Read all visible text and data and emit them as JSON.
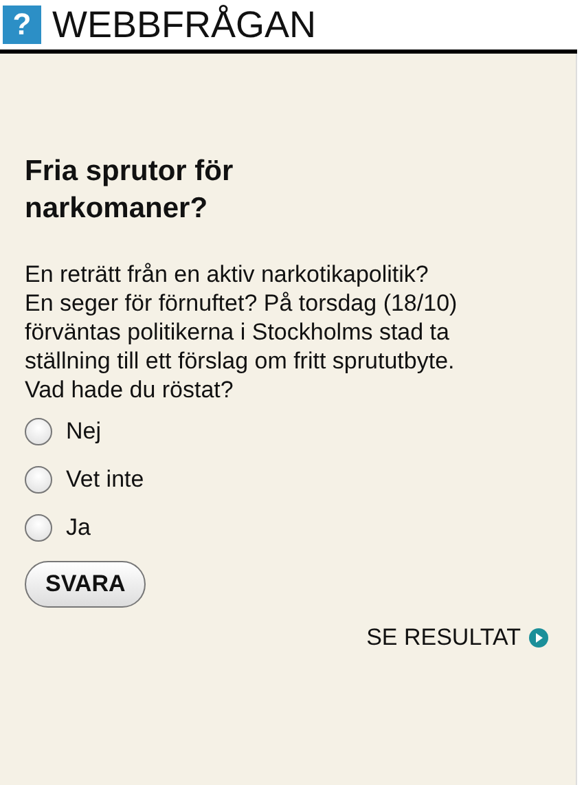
{
  "header": {
    "icon": "?",
    "title": "WEBBFRÅGAN"
  },
  "poll": {
    "question": "Fria sprutor för narkomaner?",
    "description": "En reträtt från en aktiv narkotikapolitik? En seger för förnuftet? På torsdag (18/10) förväntas politikerna i Stockholms stad ta ställning till ett förslag om fritt sprututbyte. Vad hade du röstat?",
    "options": [
      {
        "label": "Nej",
        "selected": false
      },
      {
        "label": "Vet inte",
        "selected": false
      },
      {
        "label": "Ja",
        "selected": false
      }
    ],
    "submit": "SVARA",
    "results_link": "SE RESULTAT"
  }
}
